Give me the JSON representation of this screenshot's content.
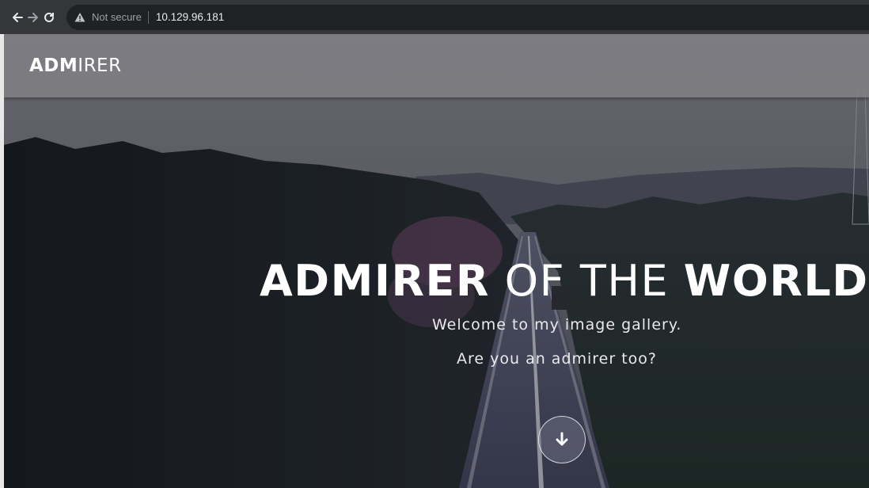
{
  "browser": {
    "security_label": "Not secure",
    "url": "10.129.96.181"
  },
  "header": {
    "logo_bold": "ADM",
    "logo_light": "IRER"
  },
  "hero": {
    "title_part1": "ADMIRER",
    "title_part2": "OF THE",
    "title_part3": "WORLD.",
    "subtitle_line1": "Welcome to my image gallery.",
    "subtitle_line2": "Are you an admirer too?"
  },
  "icons": {
    "back": "arrow-left-icon",
    "forward": "arrow-right-icon",
    "reload": "reload-icon",
    "security": "warning-triangle-icon",
    "scroll": "arrow-down-icon"
  },
  "colors": {
    "chrome_bg": "#35363a",
    "omnibox_bg": "#202124",
    "header_bg": "#828287",
    "hero_text": "#ffffff"
  }
}
